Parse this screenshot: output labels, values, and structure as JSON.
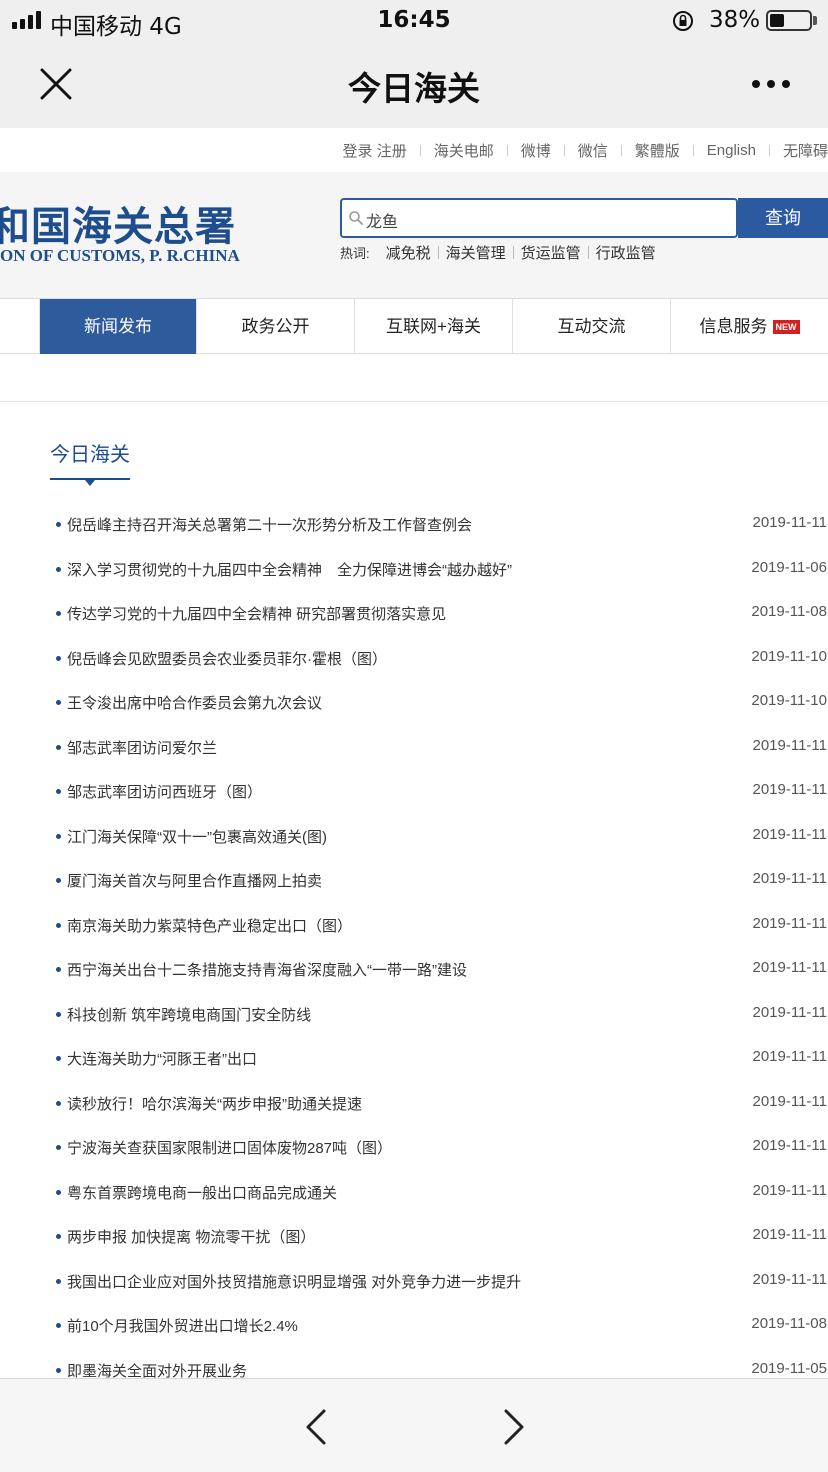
{
  "status_bar": {
    "carrier": "中国移动   4G",
    "time": "16:45",
    "battery": "38%",
    "battery_level": 0.38
  },
  "navbar": {
    "title": "今日海关",
    "close_icon": "close-icon",
    "more_icon": "more-dots-icon"
  },
  "top_links": [
    "登录 注册",
    "海关电邮",
    "微博",
    "微信",
    "繁體版",
    "English",
    "无障碍"
  ],
  "header": {
    "logo_cn": "和国海关总署",
    "logo_en": "ON OF CUSTOMS, P. R.CHINA",
    "search_value": "龙鱼",
    "search_button": "查询",
    "hot_label": "热词:",
    "hot_words": [
      "减免税",
      "海关管理",
      "货运监管",
      "行政监管"
    ]
  },
  "tabs": [
    {
      "label": "新闻发布"
    },
    {
      "label": "政务公开"
    },
    {
      "label": "互联网+海关"
    },
    {
      "label": "互动交流"
    },
    {
      "label": "信息服务",
      "badge": "NEW"
    }
  ],
  "section_title": "今日海关",
  "news": [
    {
      "title": "倪岳峰主持召开海关总署第二十一次形势分析及工作督查例会",
      "date": "2019-11-11"
    },
    {
      "title": "深入学习贯彻党的十九届四中全会精神　全力保障进博会“越办越好”",
      "date": "2019-11-06"
    },
    {
      "title": "传达学习党的十九届四中全会精神 研究部署贯彻落实意见",
      "date": "2019-11-08"
    },
    {
      "title": "倪岳峰会见欧盟委员会农业委员菲尔·霍根（图）",
      "date": "2019-11-10"
    },
    {
      "title": "王令浚出席中哈合作委员会第九次会议",
      "date": "2019-11-10"
    },
    {
      "title": "邹志武率团访问爱尔兰",
      "date": "2019-11-11"
    },
    {
      "title": "邹志武率团访问西班牙（图）",
      "date": "2019-11-11"
    },
    {
      "title": "江门海关保障“双十一”包裹高效通关(图)",
      "date": "2019-11-11"
    },
    {
      "title": "厦门海关首次与阿里合作直播网上拍卖",
      "date": "2019-11-11"
    },
    {
      "title": "南京海关助力紫菜特色产业稳定出口（图）",
      "date": "2019-11-11"
    },
    {
      "title": "西宁海关出台十二条措施支持青海省深度融入“一带一路”建设",
      "date": "2019-11-11"
    },
    {
      "title": "科技创新 筑牢跨境电商国门安全防线",
      "date": "2019-11-11"
    },
    {
      "title": "大连海关助力“河豚王者”出口",
      "date": "2019-11-11"
    },
    {
      "title": "读秒放行！哈尔滨海关“两步申报”助通关提速",
      "date": "2019-11-11"
    },
    {
      "title": "宁波海关查获国家限制进口固体废物287吨（图）",
      "date": "2019-11-11"
    },
    {
      "title": "粤东首票跨境电商一般出口商品完成通关",
      "date": "2019-11-11"
    },
    {
      "title": "两步申报 加快提离 物流零干扰（图）",
      "date": "2019-11-11"
    },
    {
      "title": "我国出口企业应对国外技贸措施意识明显增强 对外竞争力进一步提升",
      "date": "2019-11-11"
    },
    {
      "title": "前10个月我国外贸进出口增长2.4%",
      "date": "2019-11-08"
    },
    {
      "title": "即墨海关全面对外开展业务",
      "date": "2019-11-05"
    }
  ],
  "bottom_bar": {
    "back_icon": "chevron-left-icon",
    "forward_icon": "chevron-right-icon"
  },
  "colors": {
    "brand": "#1d4d8c",
    "accent": "#2e5b9b",
    "badge": "#d4201f"
  }
}
